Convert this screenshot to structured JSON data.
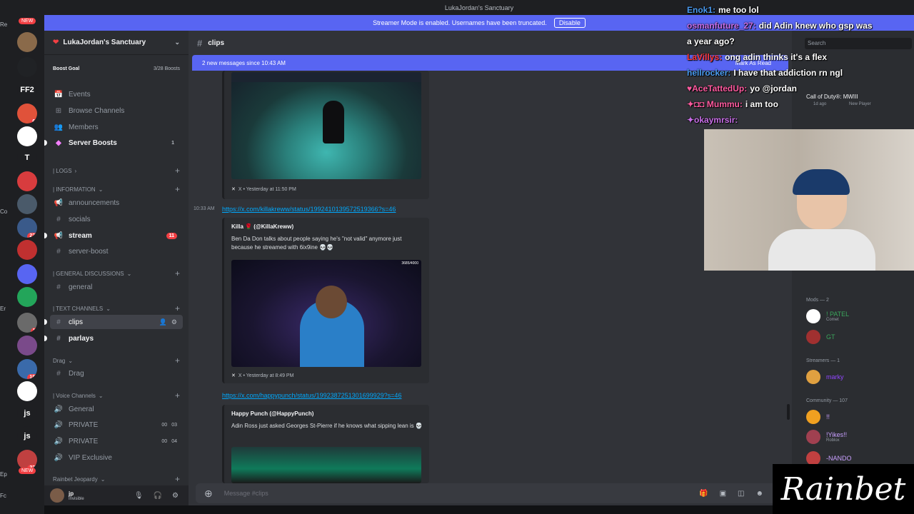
{
  "window": {
    "title": "LukaJordan's Sanctuary"
  },
  "banner": {
    "text": "Streamer Mode is enabled. Usernames have been truncated.",
    "button": "Disable"
  },
  "rail": {
    "left_labels": [
      "Re",
      "Co",
      "Er",
      "Ep",
      "Fc"
    ],
    "servers": [
      {
        "label": "",
        "color": "#8a6a4a",
        "badge": ""
      },
      {
        "label": "",
        "color": "#202225",
        "badge": ""
      },
      {
        "label": "FF2",
        "color": "#1e1f22",
        "badge": ""
      },
      {
        "label": "",
        "color": "#e0523a",
        "badge": "62"
      },
      {
        "label": "",
        "color": "#ffffff",
        "badge": ""
      },
      {
        "label": "T",
        "color": "#1e1f22",
        "badge": ""
      },
      {
        "label": "",
        "color": "#d83c3e",
        "badge": ""
      },
      {
        "label": "",
        "color": "#4a5a6a",
        "badge": ""
      },
      {
        "label": "",
        "color": "#3a5a8a",
        "badge": "239"
      },
      {
        "label": "",
        "color": "#c03030",
        "badge": ""
      },
      {
        "label": "",
        "color": "#5865f2",
        "badge": ""
      },
      {
        "label": "",
        "color": "#23a55a",
        "badge": ""
      },
      {
        "label": "",
        "color": "#6a6a6a",
        "badge": "11"
      },
      {
        "label": "",
        "color": "#7a4a8a",
        "badge": ""
      },
      {
        "label": "",
        "color": "#3a6aaa",
        "badge": "185"
      },
      {
        "label": "",
        "color": "#ffffff",
        "badge": ""
      },
      {
        "label": "js",
        "color": "#1e1f22",
        "badge": ""
      },
      {
        "label": "js",
        "color": "#1e1f22",
        "badge": ""
      },
      {
        "label": "",
        "color": "#c04040",
        "badge": "237"
      }
    ],
    "new_badge": "NEW"
  },
  "sidebar": {
    "server_name": "LukaJordan's Sanctuary",
    "boost_goal": "Boost Goal",
    "boost_count": "3/28 Boosts",
    "top_items": [
      {
        "icon": "📅",
        "label": "Events"
      },
      {
        "icon": "⊞",
        "label": "Browse Channels"
      },
      {
        "icon": "👥",
        "label": "Members"
      },
      {
        "icon": "◆",
        "label": "Server Boosts",
        "count": "1"
      }
    ],
    "categories": {
      "logs": "| LOGS",
      "information": "| INFORMATION",
      "general": "| GENERAL DISCUSSIONS",
      "text": "| TEXT CHANNELS",
      "drag": "Drag",
      "voice": "| Voice Channels",
      "rainbet": "Rainbet Jeopardy"
    },
    "channels": {
      "announcements": "announcements",
      "socials": "socials",
      "stream": "stream",
      "stream_count": "11",
      "server_boost": "server-boost",
      "general": "general",
      "clips": "clips",
      "parlays": "parlays",
      "drag": "Drag",
      "voice_general": "General",
      "private1": "PRIVATE",
      "private1_a": "00",
      "private1_b": "03",
      "private2": "PRIVATE",
      "private2_a": "00",
      "private2_b": "04",
      "vip": "VIP Exclusive"
    }
  },
  "user": {
    "name": "jp",
    "status": "Invisible"
  },
  "main": {
    "channel": "clips",
    "new_messages": "2 new messages since 10:43 AM",
    "mark_as_read": "Mark As Read",
    "embed1": {
      "footer": "X • Yesterday at 11:50 PM"
    },
    "msg2": {
      "time": "10:33 AM",
      "link": "https://x.com/killakreww/status/1992410139572519366?s=46",
      "author": "Killa 🌹 (@KillaKreww)",
      "text": "Ben Da Don talks about people saying he's \"not valid\" anymore just because he streamed with 6ix9ine 💀💀",
      "counter": "3685/4000",
      "footer": "X • Yesterday at 8:49 PM"
    },
    "msg3": {
      "link": "https://x.com/happypunch/status/1992387251301699929?s=46",
      "author": "Happy Punch (@HappyPunch)",
      "text": "Adin Ross just asked Georges St-Pierre if he knows what sipping lean is 💀"
    },
    "composer_placeholder": "Message #clips"
  },
  "members": {
    "search": "Search",
    "game": "Call of Duty®: MWIII",
    "game_sub": "1d ago",
    "game_sub2": "New Player",
    "mods_header": "Mods — 2",
    "mods": [
      {
        "name": "! PATEL",
        "sub": "Comet",
        "color": "#3ba55c",
        "av": "#ffffff"
      },
      {
        "name": "GT",
        "sub": "",
        "color": "#3ba55c",
        "av": "#a03030"
      }
    ],
    "streamers_header": "Streamers — 1",
    "streamers": [
      {
        "name": "marky",
        "sub": "",
        "color": "#9146ff",
        "av": "#e0a040"
      }
    ],
    "community_header": "Community — 107",
    "community": [
      {
        "name": "!!",
        "sub": "",
        "color": "#c9a0ff",
        "av": "#f0a020"
      },
      {
        "name": "!Yikes!!",
        "sub": "Roblox",
        "color": "#c9a0ff",
        "av": "#a04050"
      },
      {
        "name": "-NANDO",
        "sub": "",
        "color": "#c9a0ff",
        "av": "#c04040"
      }
    ]
  },
  "chat": [
    {
      "user": "Enok1:",
      "msg": "me too lol",
      "color": "#4a9bf0"
    },
    {
      "user": "osmanfuture_27:",
      "msg": "did Adin knew who gsp was",
      "color": "#c86ee8"
    },
    {
      "user": "",
      "msg": "a year ago?",
      "color": "#ffffff"
    },
    {
      "user": "LaVillys:",
      "msg": "ong adin thinks it's a flex",
      "color": "#ff3a3a"
    },
    {
      "user": "hellrocker:",
      "msg": "I have that addiction rn ngl",
      "color": "#4a9bf0"
    },
    {
      "user": "♥AceTattedUp:",
      "msg": "yo @jordan",
      "color": "#ff5aa0"
    },
    {
      "user": "✦◘◘ Mummu:",
      "msg": "i am too",
      "color": "#ff5aa0"
    },
    {
      "user": "✦okaymrsir:",
      "msg": "",
      "color": "#c86ee8"
    }
  ],
  "overlay": {
    "brand": "Rainbet"
  }
}
